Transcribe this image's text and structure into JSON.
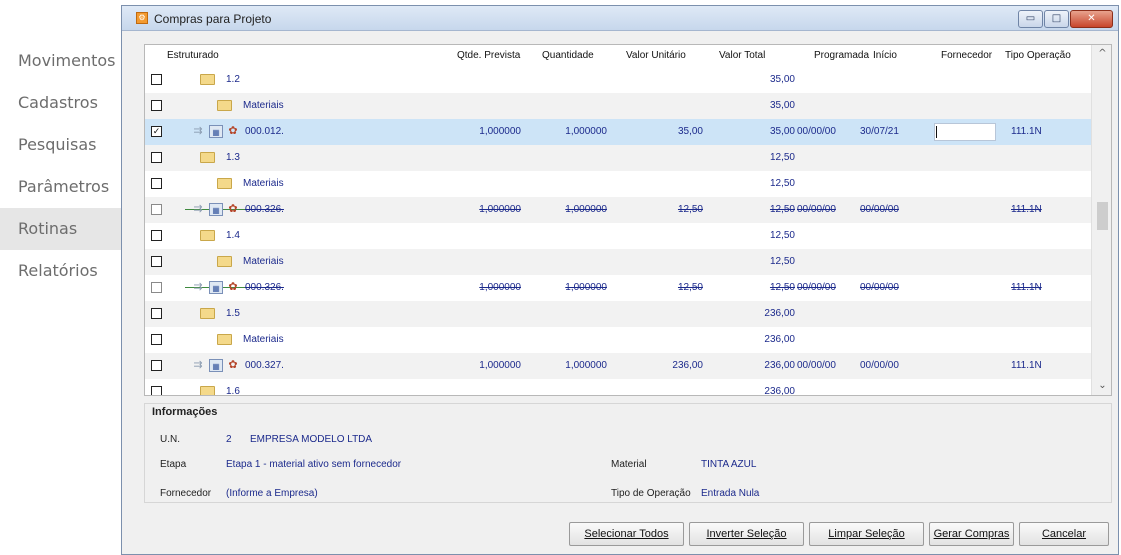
{
  "sidebar": {
    "items": [
      {
        "label": "Movimentos",
        "active": false
      },
      {
        "label": "Cadastros",
        "active": false
      },
      {
        "label": "Pesquisas",
        "active": false
      },
      {
        "label": "Parâmetros",
        "active": false
      },
      {
        "label": "Rotinas",
        "active": true
      },
      {
        "label": "Relatórios",
        "active": false
      }
    ]
  },
  "window": {
    "title": "Compras para Projeto",
    "minimize_glyph": "▭",
    "maximize_glyph": "□",
    "close_glyph": "✕"
  },
  "grid": {
    "columns": [
      "Estruturado",
      "Qtde. Prevista",
      "Quantidade",
      "Valor Unitário",
      "Valor Total",
      "Programada",
      "Início",
      "Fornecedor",
      "Tipo Operação"
    ],
    "rows": [
      {
        "type": "folder",
        "indent": 1,
        "checked": false,
        "label": "1.2",
        "valor_total": "35,00"
      },
      {
        "type": "folder",
        "indent": 2,
        "checked": false,
        "label": "Materiais",
        "valor_total": "35,00"
      },
      {
        "type": "item",
        "checked": true,
        "selected": true,
        "strike": false,
        "code": "000.012.",
        "qtde_prevista": "1,000000",
        "quantidade": "1,000000",
        "valor_unitario": "35,00",
        "valor_total": "35,00",
        "programada": "00/00/00",
        "inicio": "30/07/21",
        "tipo_operacao": "111.1N"
      },
      {
        "type": "folder",
        "indent": 1,
        "checked": false,
        "label": "1.3",
        "valor_total": "12,50"
      },
      {
        "type": "folder",
        "indent": 2,
        "checked": false,
        "label": "Materiais",
        "valor_total": "12,50"
      },
      {
        "type": "item",
        "checked": false,
        "selected": false,
        "strike": true,
        "code": "000.326.",
        "qtde_prevista": "1,000000",
        "quantidade": "1,000000",
        "valor_unitario": "12,50",
        "valor_total": "12,50",
        "programada": "00/00/00",
        "inicio": "00/00/00",
        "tipo_operacao": "111.1N"
      },
      {
        "type": "folder",
        "indent": 1,
        "checked": false,
        "label": "1.4",
        "valor_total": "12,50"
      },
      {
        "type": "folder",
        "indent": 2,
        "checked": false,
        "label": "Materiais",
        "valor_total": "12,50"
      },
      {
        "type": "item",
        "checked": false,
        "selected": false,
        "strike": true,
        "code": "000.326.",
        "qtde_prevista": "1,000000",
        "quantidade": "1,000000",
        "valor_unitario": "12,50",
        "valor_total": "12,50",
        "programada": "00/00/00",
        "inicio": "00/00/00",
        "tipo_operacao": "111.1N"
      },
      {
        "type": "folder",
        "indent": 1,
        "checked": false,
        "label": "1.5",
        "valor_total": "236,00"
      },
      {
        "type": "folder",
        "indent": 2,
        "checked": false,
        "label": "Materiais",
        "valor_total": "236,00"
      },
      {
        "type": "item",
        "checked": false,
        "selected": false,
        "strike": false,
        "code": "000.327.",
        "qtde_prevista": "1,000000",
        "quantidade": "1,000000",
        "valor_unitario": "236,00",
        "valor_total": "236,00",
        "programada": "00/00/00",
        "inicio": "00/00/00",
        "tipo_operacao": "111.1N"
      },
      {
        "type": "folder",
        "indent": 1,
        "checked": false,
        "label": "1.6",
        "valor_total": "236,00"
      }
    ],
    "icons": [
      "component-icon",
      "grid-icon",
      "pricetag-icon",
      "folder-icon"
    ]
  },
  "info": {
    "title": "Informações",
    "un_label": "U.N.",
    "un_code": "2",
    "un_name": "EMPRESA MODELO LTDA",
    "etapa_label": "Etapa",
    "etapa_value": "Etapa 1 - material ativo sem fornecedor",
    "fornecedor_label": "Fornecedor",
    "fornecedor_value": "(Informe a Empresa)",
    "material_label": "Material",
    "material_value": "TINTA AZUL",
    "tipo_label": "Tipo de Operação",
    "tipo_value": "Entrada Nula"
  },
  "buttons": {
    "select_all": "Selecionar Todos",
    "invert": "Inverter Seleção",
    "clear": "Limpar Seleção",
    "generate": "Gerar Compras",
    "cancel": "Cancelar"
  },
  "scroll": {
    "up": "^",
    "down": "⌄"
  }
}
